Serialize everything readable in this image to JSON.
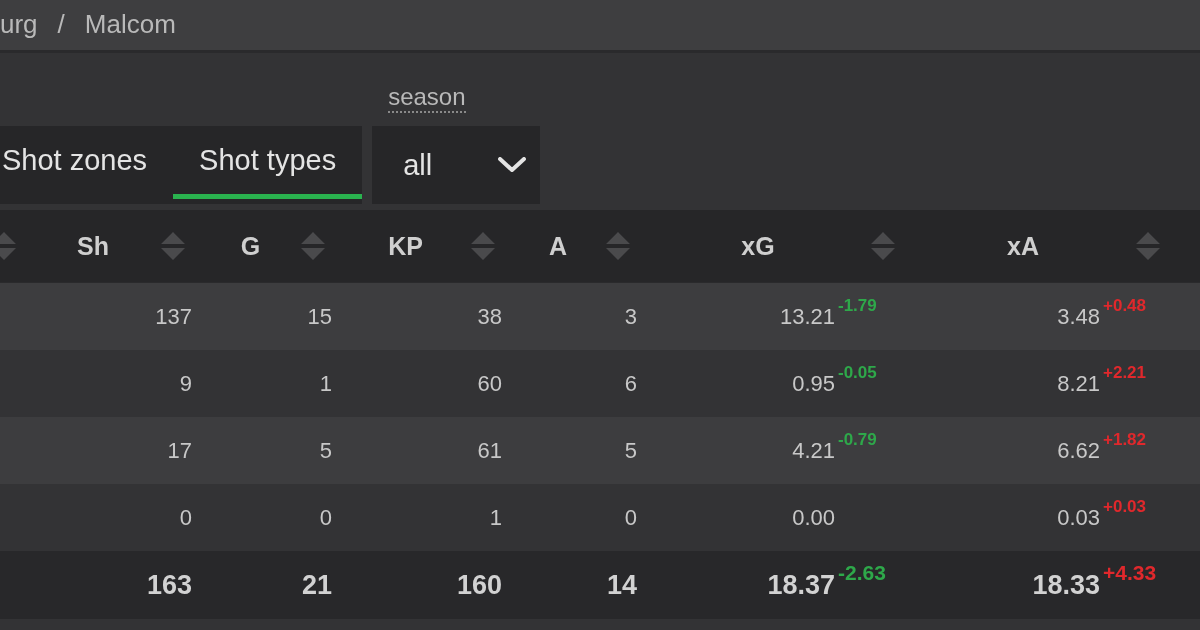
{
  "breadcrumb": {
    "items": [
      {
        "label": "urg"
      },
      {
        "label": "Malcom"
      }
    ],
    "separator": "/"
  },
  "filters": {
    "tabs": [
      {
        "label": "Shot zones",
        "selected": false
      },
      {
        "label": "Shot types",
        "selected": true
      }
    ],
    "season": {
      "label": "season",
      "value": "all"
    }
  },
  "table": {
    "columns": [
      {
        "label": "Sh"
      },
      {
        "label": "G"
      },
      {
        "label": "KP"
      },
      {
        "label": "A"
      },
      {
        "label": "xG"
      },
      {
        "label": "xA"
      }
    ],
    "rows": [
      {
        "cells": [
          {
            "value": "137"
          },
          {
            "value": "15"
          },
          {
            "value": "38"
          },
          {
            "value": "3"
          },
          {
            "value": "13.21",
            "delta": {
              "text": "-1.79",
              "color": "#2ea84a"
            }
          },
          {
            "value": "3.48",
            "delta": {
              "text": "+0.48",
              "color": "#e0282c"
            }
          }
        ]
      },
      {
        "cells": [
          {
            "value": "9"
          },
          {
            "value": "1"
          },
          {
            "value": "60"
          },
          {
            "value": "6"
          },
          {
            "value": "0.95",
            "delta": {
              "text": "-0.05",
              "color": "#2ea84a"
            }
          },
          {
            "value": "8.21",
            "delta": {
              "text": "+2.21",
              "color": "#e0282c"
            }
          }
        ]
      },
      {
        "cells": [
          {
            "value": "17"
          },
          {
            "value": "5"
          },
          {
            "value": "61"
          },
          {
            "value": "5"
          },
          {
            "value": "4.21",
            "delta": {
              "text": "-0.79",
              "color": "#2ea84a"
            }
          },
          {
            "value": "6.62",
            "delta": {
              "text": "+1.82",
              "color": "#e0282c"
            }
          }
        ]
      },
      {
        "cells": [
          {
            "value": "0"
          },
          {
            "value": "0"
          },
          {
            "value": "1"
          },
          {
            "value": "0"
          },
          {
            "value": "0.00"
          },
          {
            "value": "0.03",
            "delta": {
              "text": "+0.03",
              "color": "#e0282c"
            }
          }
        ]
      }
    ],
    "total": {
      "cells": [
        {
          "value": "163"
        },
        {
          "value": "21"
        },
        {
          "value": "160"
        },
        {
          "value": "14"
        },
        {
          "value": "18.37",
          "delta": {
            "text": "-2.63",
            "color": "#2ea84a"
          }
        },
        {
          "value": "18.33",
          "delta": {
            "text": "+4.33",
            "color": "#e0282c"
          }
        }
      ]
    }
  }
}
